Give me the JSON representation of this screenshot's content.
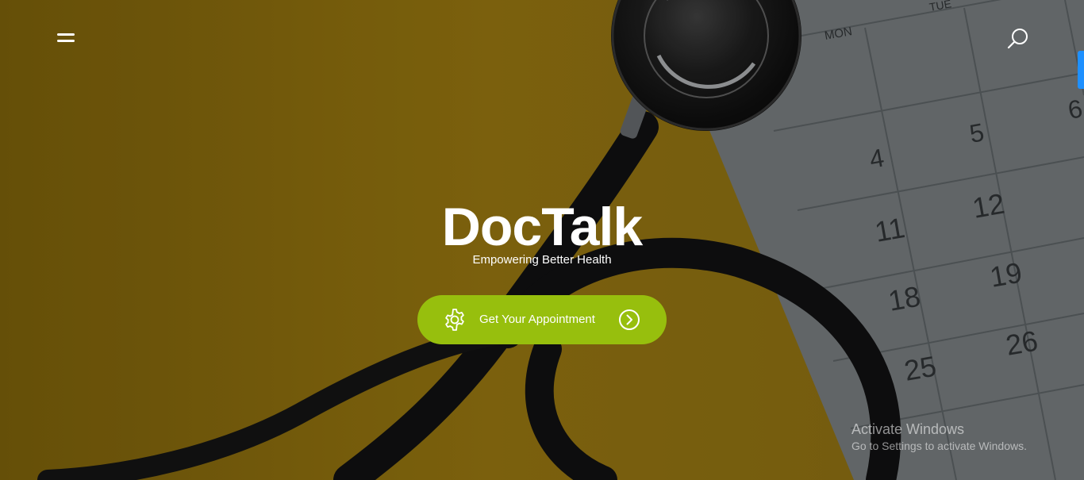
{
  "header": {
    "menu_icon": "hamburger-menu-icon",
    "search_icon": "search-icon"
  },
  "hero": {
    "brand": "DocTalk",
    "tagline": "Empowering Better Health",
    "cta": {
      "label": "Get Your Appointment",
      "leading_icon": "gear-icon",
      "trailing_icon": "chevron-right-circle-icon"
    },
    "background": {
      "description_icon": "stethoscope-and-calendar-image",
      "calendar_days": [
        "MON",
        "TUE"
      ],
      "calendar_numbers": [
        "4",
        "5",
        "6",
        "11",
        "12",
        "18",
        "19",
        "25",
        "26"
      ]
    }
  },
  "overlay": {
    "activation_title": "Activate Windows",
    "activation_subtitle": "Go to Settings to activate Windows."
  },
  "colors": {
    "background_mustard": "#7d6210",
    "cta_green": "#97bf0d",
    "side_tab_blue": "#1e90ff"
  }
}
